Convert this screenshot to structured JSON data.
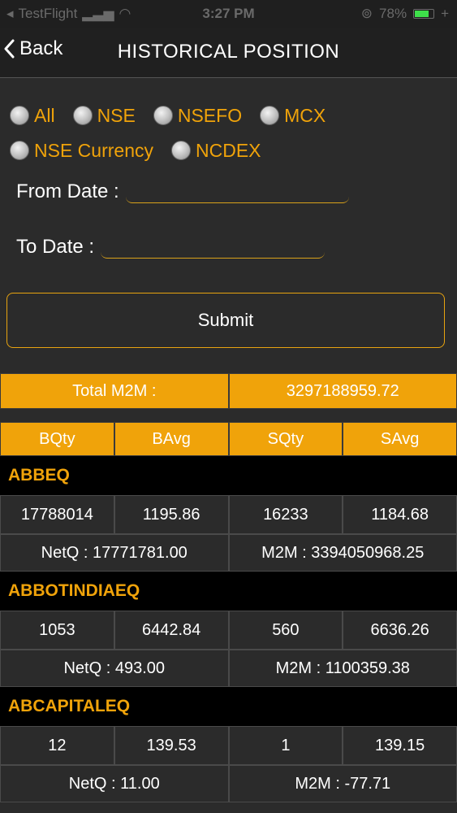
{
  "status_bar": {
    "carrier": "TestFlight",
    "time": "3:27 PM",
    "battery": "78%",
    "battery_level": 0.78
  },
  "nav": {
    "back_label": "Back",
    "title": "HISTORICAL POSITION"
  },
  "filters": {
    "radios": [
      {
        "label": "All"
      },
      {
        "label": "NSE"
      },
      {
        "label": "NSEFO"
      },
      {
        "label": "MCX"
      },
      {
        "label": "NSE Currency"
      },
      {
        "label": "NCDEX"
      }
    ],
    "from_label": "From Date :",
    "to_label": "To Date :",
    "from_value": "",
    "to_value": "",
    "submit_label": "Submit"
  },
  "summary": {
    "total_label": "Total M2M :",
    "total_value": "3297188959.72"
  },
  "columns": [
    "BQty",
    "BAvg",
    "SQty",
    "SAvg"
  ],
  "positions": [
    {
      "symbol": "ABBEQ",
      "bqty": "17788014",
      "bavg": "1195.86",
      "sqty": "16233",
      "savg": "1184.68",
      "netq": "NetQ : 17771781.00",
      "m2m": "M2M : 3394050968.25"
    },
    {
      "symbol": "ABBOTINDIAEQ",
      "bqty": "1053",
      "bavg": "6442.84",
      "sqty": "560",
      "savg": "6636.26",
      "netq": "NetQ : 493.00",
      "m2m": "M2M : 1100359.38"
    },
    {
      "symbol": "ABCAPITALEQ",
      "bqty": "12",
      "bavg": "139.53",
      "sqty": "1",
      "savg": "139.15",
      "netq": "NetQ : 11.00",
      "m2m": "M2M : -77.71"
    }
  ],
  "colors": {
    "accent": "#f0a30a",
    "background": "#2b2b2b",
    "symbol_row": "#000000"
  }
}
